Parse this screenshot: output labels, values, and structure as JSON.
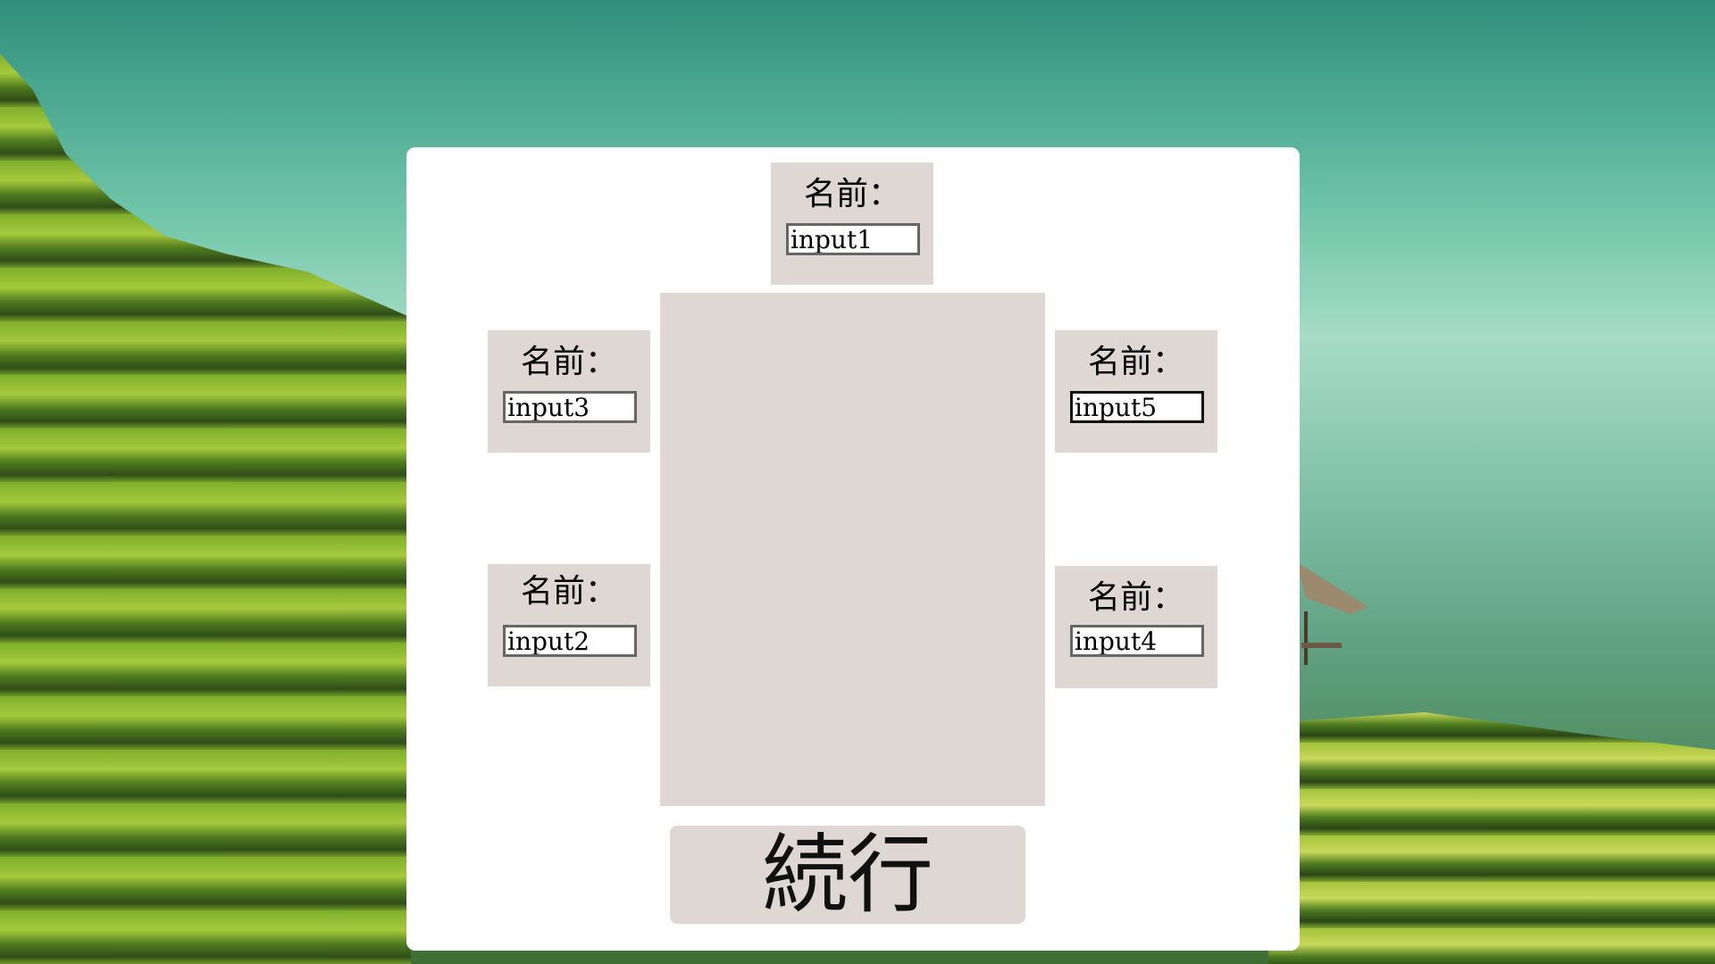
{
  "seats": {
    "seat1": {
      "label": "名前：",
      "value": "input1"
    },
    "seat2": {
      "label": "名前：",
      "value": "input2"
    },
    "seat3": {
      "label": "名前：",
      "value": "input3"
    },
    "seat4": {
      "label": "名前：",
      "value": "input4"
    },
    "seat5": {
      "label": "名前：",
      "value": "input5"
    }
  },
  "continue_button": {
    "label": "続行"
  },
  "colors": {
    "panel": "#ffffff",
    "seat_background": "#dfd7d3",
    "input_border": "#666666"
  }
}
